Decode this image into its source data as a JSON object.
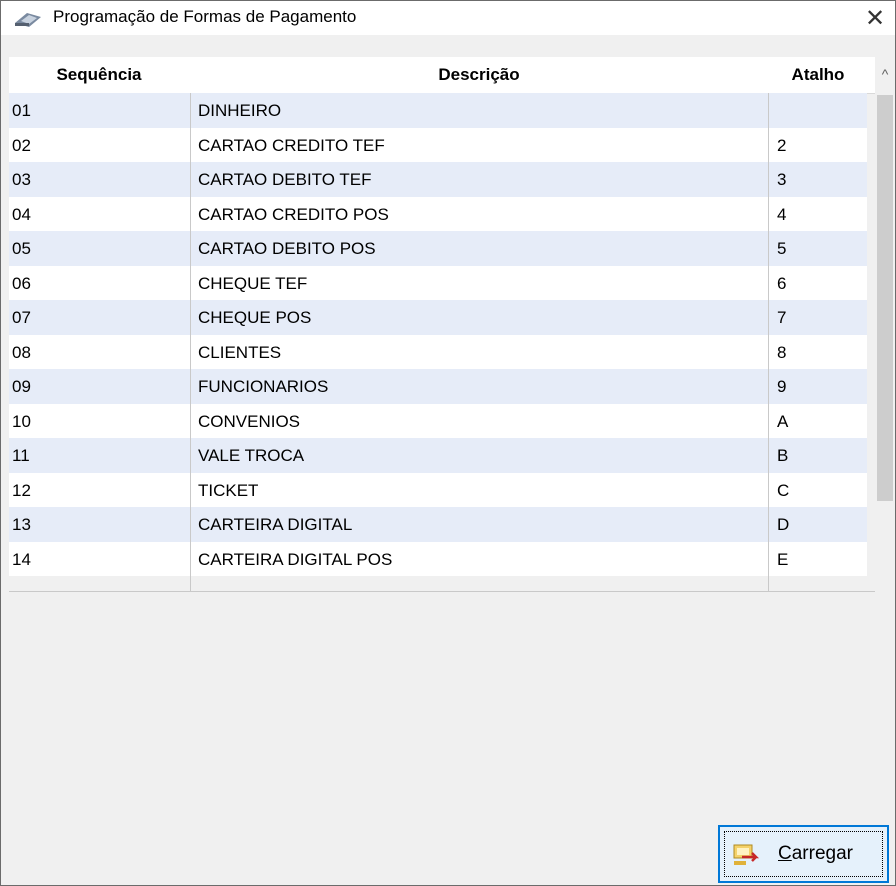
{
  "window": {
    "title": "Programação de Formas de Pagamento",
    "close_symbol": "✕"
  },
  "grid": {
    "headers": {
      "sequence": "Sequência",
      "description": "Descrição",
      "shortcut": "Atalho"
    },
    "rows": [
      {
        "seq": "01",
        "desc": "DINHEIRO",
        "key": ""
      },
      {
        "seq": "02",
        "desc": "CARTAO CREDITO TEF",
        "key": "2"
      },
      {
        "seq": "03",
        "desc": "CARTAO DEBITO TEF",
        "key": "3"
      },
      {
        "seq": "04",
        "desc": "CARTAO CREDITO POS",
        "key": "4"
      },
      {
        "seq": "05",
        "desc": "CARTAO DEBITO POS",
        "key": "5"
      },
      {
        "seq": "06",
        "desc": "CHEQUE TEF",
        "key": "6"
      },
      {
        "seq": "07",
        "desc": "CHEQUE POS",
        "key": "7"
      },
      {
        "seq": "08",
        "desc": "CLIENTES",
        "key": "8"
      },
      {
        "seq": "09",
        "desc": "FUNCIONARIOS",
        "key": "9"
      },
      {
        "seq": "10",
        "desc": "CONVENIOS",
        "key": "A"
      },
      {
        "seq": "11",
        "desc": "VALE TROCA",
        "key": "B"
      },
      {
        "seq": "12",
        "desc": "TICKET",
        "key": "C"
      },
      {
        "seq": "13",
        "desc": "CARTEIRA DIGITAL",
        "key": "D"
      },
      {
        "seq": "14",
        "desc": "CARTEIRA DIGITAL POS",
        "key": "E"
      }
    ]
  },
  "scrollbar": {
    "up_symbol": "^",
    "down_symbol": "⌄"
  },
  "footer": {
    "load_button": {
      "mnemonic": "C",
      "rest": "arregar"
    }
  }
}
